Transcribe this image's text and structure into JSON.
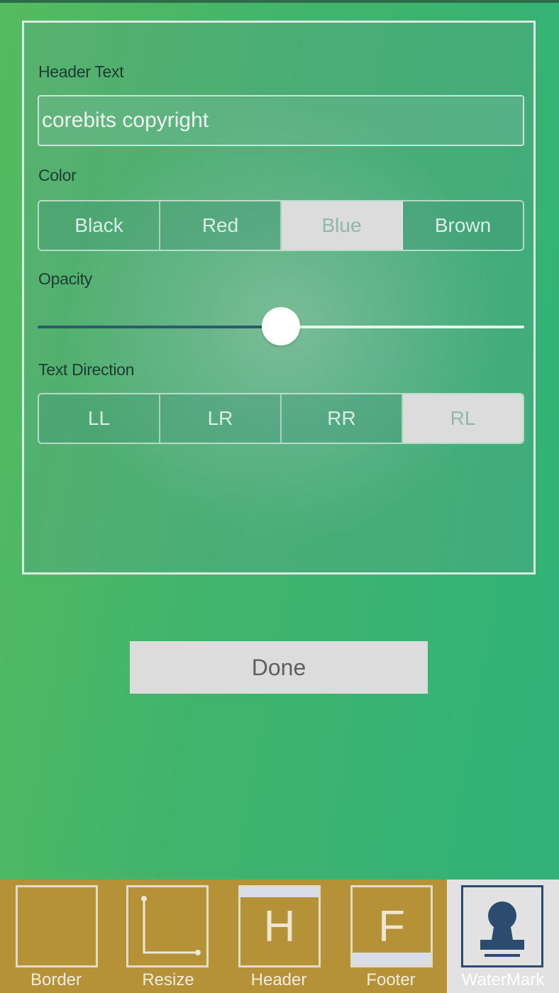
{
  "form": {
    "header_text_label": "Header Text",
    "header_text_value": "corebits copyright",
    "color_label": "Color",
    "color_options": [
      "Black",
      "Red",
      "Blue",
      "Brown"
    ],
    "color_selected": "Blue",
    "opacity_label": "Opacity",
    "opacity_value": 0.5,
    "text_direction_label": "Text Direction",
    "direction_options": [
      "LL",
      "LR",
      "RR",
      "RL"
    ],
    "direction_selected": "RL"
  },
  "done_label": "Done",
  "toolbar": {
    "items": [
      {
        "label": "Border",
        "icon": "border-icon"
      },
      {
        "label": "Resize",
        "icon": "resize-icon"
      },
      {
        "label": "Header",
        "icon": "header-icon",
        "glyph": "H"
      },
      {
        "label": "Footer",
        "icon": "footer-icon",
        "glyph": "F"
      },
      {
        "label": "WaterMark",
        "icon": "stamp-icon"
      }
    ],
    "active": "WaterMark"
  },
  "colors": {
    "toolbar_bg": "#b59238",
    "slider_min_track": "#2e5a6a",
    "selected_segment": "#dcdcdc"
  }
}
